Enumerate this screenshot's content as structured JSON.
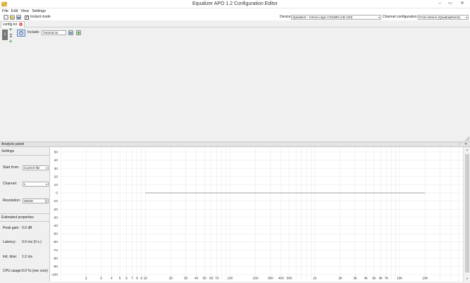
{
  "window": {
    "title": "Equalizer APO 1.2 Configuration Editor"
  },
  "menu": [
    "File",
    "Edit",
    "View",
    "Settings"
  ],
  "toolbar": {
    "instant_mode_label": "Instant mode",
    "instant_mode_checked": "✓",
    "device_label": "Device:",
    "device_value": "Speakers - Cirrus Logic CS4280 (AB 120)",
    "channel_config_label": "Channel configuration:",
    "channel_config_value": "From device (Quadraphonic)"
  },
  "tabs": [
    {
      "label": "config.txt",
      "close": "×"
    }
  ],
  "editor": {
    "row_number": "1",
    "include_label": "Include:",
    "include_value": "Tutorial.txt",
    "add_glyph": "+"
  },
  "analysis_panel": {
    "title": "Analysis panel",
    "settings_title": "Settings",
    "start_from_label": "Start from:",
    "start_from_value": "Current file",
    "channel_label": "Channel:",
    "channel_value": "L",
    "resolution_label": "Resolution:",
    "resolution_value": "65536",
    "estimated_title": "Estimated properties",
    "peak_gain_label": "Peak gain:",
    "peak_gain_value": "0.0 dB",
    "latency_label": "Latency:",
    "latency_value": "0.0 ms (0 s.)",
    "init_time_label": "Init. time:",
    "init_time_value": "1.2 ms",
    "cpu_usage_label": "CPU usage:",
    "cpu_usage_value": "0.0 % (one core)"
  },
  "chart_data": {
    "type": "line",
    "x_scale": "log",
    "x_tick_labels": [
      "2",
      "3",
      "4",
      "5",
      "6",
      "7",
      "8",
      "9",
      "10",
      "20",
      "30",
      "40",
      "50",
      "60",
      "70",
      "100",
      "200",
      "300",
      "400",
      "500",
      "1k",
      "2k",
      "3k",
      "4k",
      "5k",
      "6k",
      "7k",
      "10k",
      "20k"
    ],
    "x_tick_values": [
      2,
      3,
      4,
      5,
      6,
      7,
      8,
      9,
      10,
      20,
      30,
      40,
      50,
      60,
      70,
      100,
      200,
      300,
      400,
      500,
      1000,
      2000,
      3000,
      4000,
      5000,
      6000,
      7000,
      10000,
      20000
    ],
    "y_ticks": [
      50,
      40,
      30,
      20,
      10,
      0,
      -10,
      -20,
      -30,
      -40,
      -50,
      -60,
      -70,
      -80,
      -90,
      -100
    ],
    "ylim": [
      -100,
      50
    ],
    "xlim": [
      1,
      50000
    ],
    "grid": true,
    "series": [
      {
        "x": [
          10,
          20000
        ],
        "y": [
          0,
          0
        ]
      }
    ],
    "colors": {
      "line": "#888888",
      "grid": "#e6e6e6"
    }
  }
}
